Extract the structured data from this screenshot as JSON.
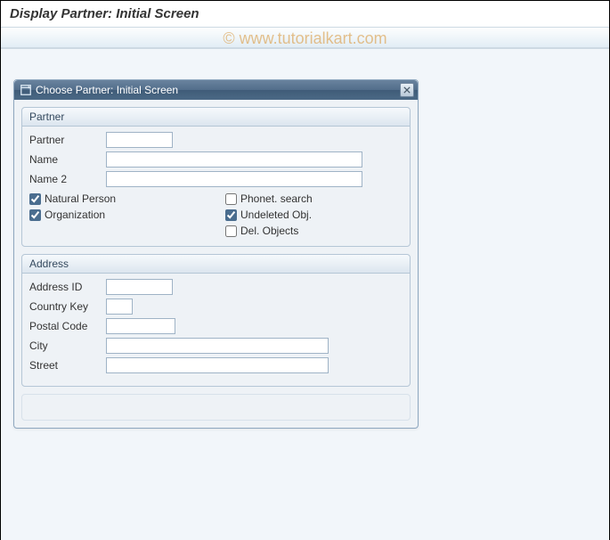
{
  "page": {
    "title": "Display Partner: Initial Screen"
  },
  "watermark": "© www.tutorialkart.com",
  "dialog": {
    "title": "Choose Partner: Initial Screen"
  },
  "partner_group": {
    "title": "Partner",
    "partner_label": "Partner",
    "partner_value": "",
    "name_label": "Name",
    "name_value": "",
    "name2_label": "Name 2",
    "name2_value": "",
    "natural_person_label": "Natural Person",
    "natural_person_checked": true,
    "organization_label": "Organization",
    "organization_checked": true,
    "phonet_search_label": "Phonet. search",
    "phonet_search_checked": false,
    "undeleted_obj_label": "Undeleted Obj.",
    "undeleted_obj_checked": true,
    "del_objects_label": "Del. Objects",
    "del_objects_checked": false
  },
  "address_group": {
    "title": "Address",
    "address_id_label": "Address ID",
    "address_id_value": "",
    "country_key_label": "Country Key",
    "country_key_value": "",
    "postal_code_label": "Postal Code",
    "postal_code_value": "",
    "city_label": "City",
    "city_value": "",
    "street_label": "Street",
    "street_value": ""
  }
}
